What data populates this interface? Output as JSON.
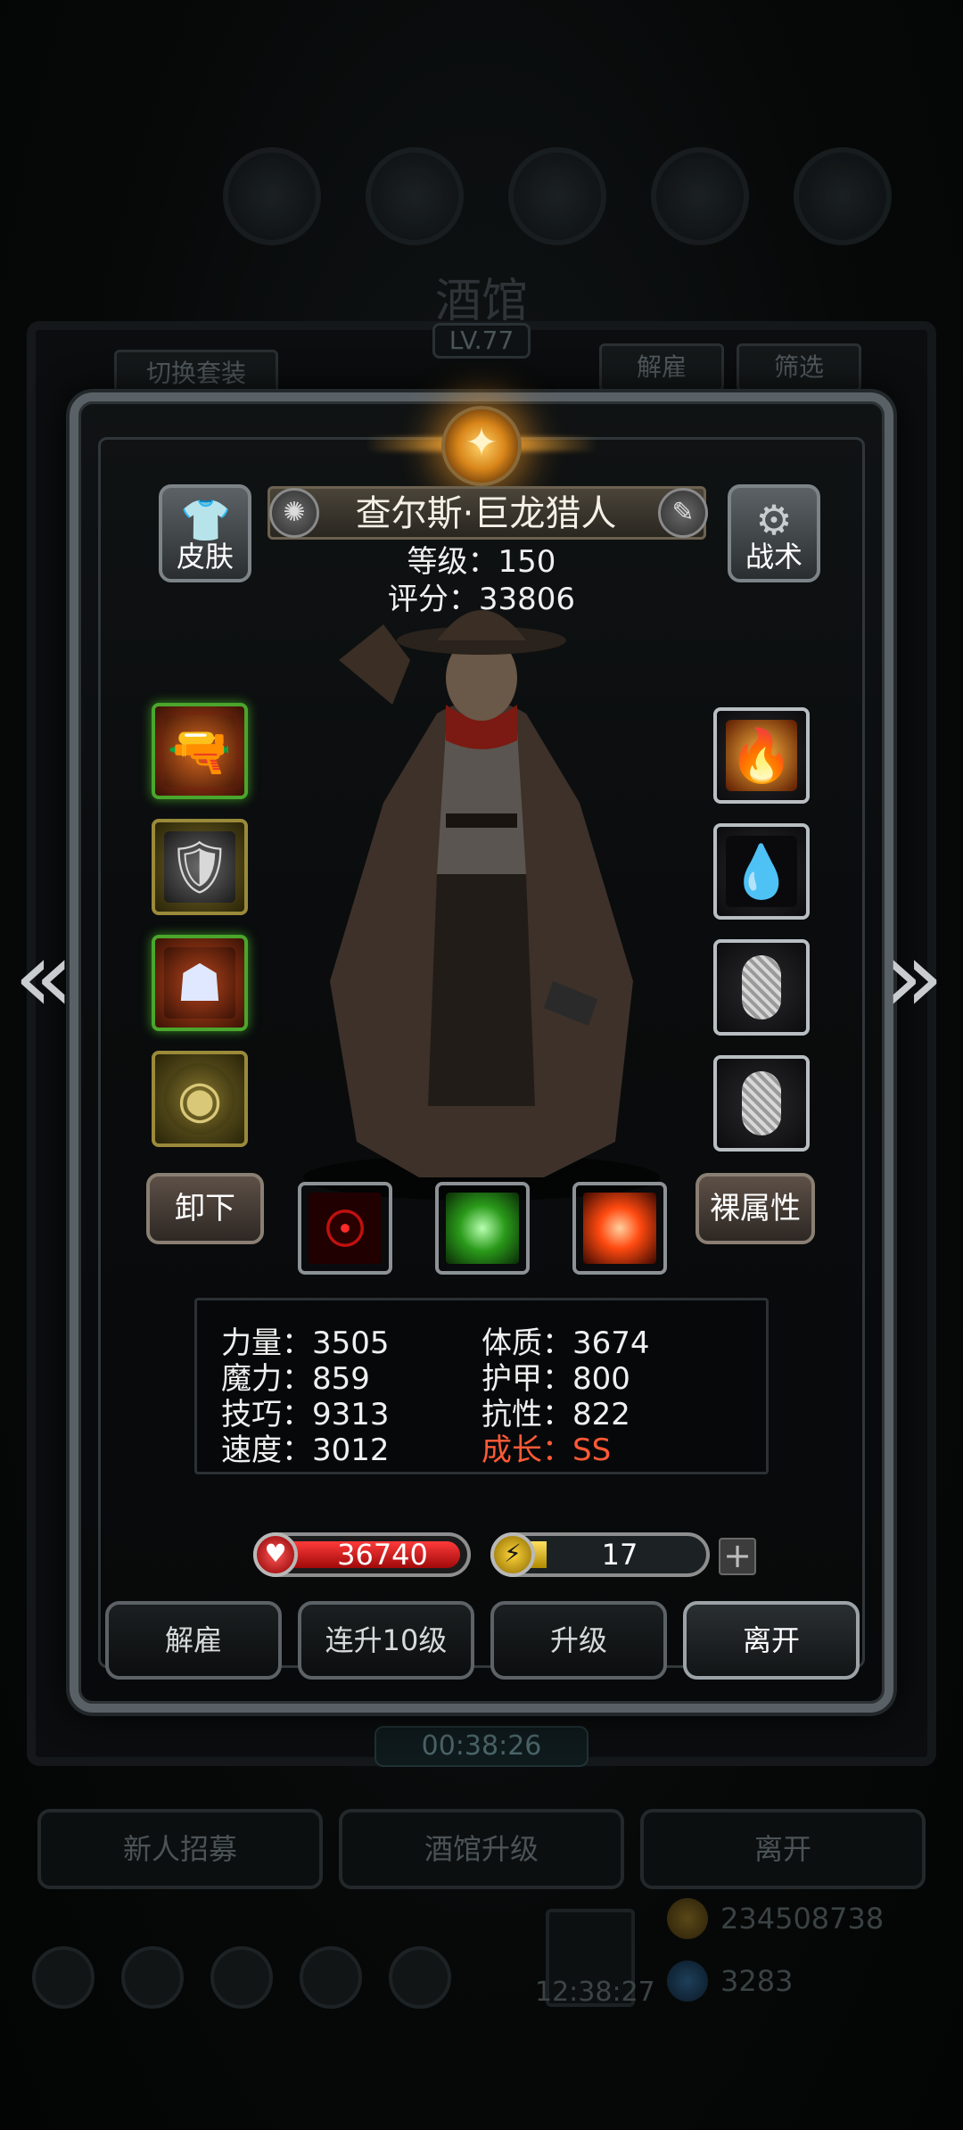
{
  "background": {
    "title": "酒馆",
    "level": "LV.77",
    "tabs": {
      "switch_outfit": "切换套装",
      "dismiss": "解雇",
      "filter": "筛选"
    },
    "timer": "00:38:26",
    "buttons": {
      "recruit": "新人招募",
      "upgrade_tavern": "酒馆升级",
      "leave": "离开"
    },
    "clock": "12:38:27",
    "resources": {
      "gold": "234508738",
      "gems": "3283"
    }
  },
  "hero": {
    "name": "查尔斯·巨龙猎人",
    "level_text": "等级：150",
    "score_text": "评分：33806",
    "skin_label": "皮肤",
    "tactics_label": "战术",
    "unequip_label": "卸下",
    "base_attr_label": "裸属性"
  },
  "equipment": {
    "left": [
      {
        "name": "weapon-shotgun",
        "rarity": "green"
      },
      {
        "name": "armor-chest",
        "rarity": "gold"
      },
      {
        "name": "helmet-mask",
        "rarity": "green"
      },
      {
        "name": "shield-round",
        "rarity": "gold"
      }
    ],
    "right": [
      {
        "name": "fire-ring",
        "rarity": "silver"
      },
      {
        "name": "blue-gem",
        "rarity": "silver"
      },
      {
        "name": "empty-slot",
        "rarity": "silver"
      },
      {
        "name": "empty-slot",
        "rarity": "silver"
      }
    ]
  },
  "skills": [
    "crosshair-skill",
    "green-beast-skill",
    "red-cross-skill"
  ],
  "stats": {
    "strength": "力量：3505",
    "magic": "魔力：859",
    "skill": "技巧：9313",
    "speed": "速度：3012",
    "constitution": "体质：3674",
    "armor": "护甲：800",
    "resistance": "抗性：822",
    "growth": "成长：SS"
  },
  "bars": {
    "hp": "36740",
    "energy": "17",
    "energy_fill": 0.1
  },
  "actions": {
    "dismiss": "解雇",
    "level_up_10": "连升10级",
    "level_up": "升级",
    "leave": "离开"
  },
  "colors": {
    "growth": "#ff5a36",
    "hp": "#d01818",
    "energy": "#ffd43a"
  }
}
